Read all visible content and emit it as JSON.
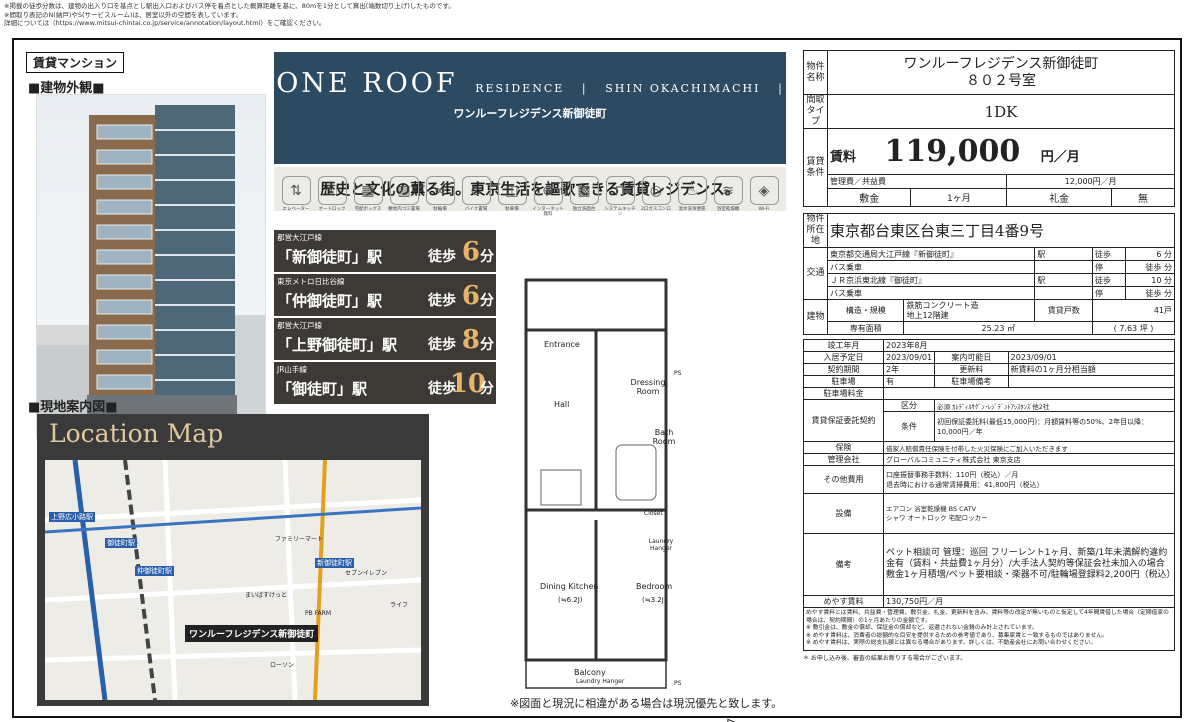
{
  "header_notes": [
    "※掲載の徒歩分数は、建物の出入り口を基点とし駅出入口およびバス停を着点とした概算距離を基に、80mを1分として算出(端数切り上げ)したものです。",
    "※間取り表記のN(納戸)やS(サービスルーム)は、居室以外の空間を表しています。",
    "詳細については（https://www.mitsui-chintai.co.jp/service/annotation/layout.html）をご確認ください。"
  ],
  "listing_type": "賃貸マンション",
  "exterior_heading": "■建物外観■",
  "map_heading": "■現地案内図■",
  "brand": {
    "main": "ONE ROOF",
    "residence": "RESIDENCE",
    "area": "SHIN OKACHIMACHI",
    "japanese": "ワンルーフレジデンス新御徒町"
  },
  "catch_copy": "歴史と文化の薫る街。東京生活を謳歌できる賃貸レジデンス。",
  "amenities": [
    {
      "icon": "elevator-icon",
      "glyph": "⇅",
      "label": "エレベーター"
    },
    {
      "icon": "autolock-icon",
      "glyph": "🔒",
      "label": "オートロック"
    },
    {
      "icon": "delivery-box-icon",
      "glyph": "▦",
      "label": "宅配ボックス"
    },
    {
      "icon": "trash-icon",
      "glyph": "🗑",
      "label": "敷地内ゴミ置場"
    },
    {
      "icon": "bicycle-icon",
      "glyph": "🚲",
      "label": "駐輪場"
    },
    {
      "icon": "bike-icon",
      "glyph": "🛵",
      "label": "バイク置場"
    },
    {
      "icon": "car-icon",
      "glyph": "🚗",
      "label": "駐車場"
    },
    {
      "icon": "internet-icon",
      "glyph": "🌐",
      "label": "インターネット無料"
    },
    {
      "icon": "floor-heating-icon",
      "glyph": "▩",
      "label": "独立洗面台"
    },
    {
      "icon": "kitchen-icon",
      "glyph": "⊓",
      "label": "システムキッチン"
    },
    {
      "icon": "stove-icon",
      "glyph": "◎",
      "label": "2口ガスコンロ"
    },
    {
      "icon": "bidet-icon",
      "glyph": "♨",
      "label": "温水洗浄便座"
    },
    {
      "icon": "bath-dryer-icon",
      "glyph": "≋",
      "label": "浴室乾燥機"
    },
    {
      "icon": "wifi-icon",
      "glyph": "◈",
      "label": "Wi-Fi"
    }
  ],
  "stations": [
    {
      "line": "都営大江戸線",
      "name": "「新御徒町」駅",
      "walk": "徒歩",
      "minutes": "6",
      "unit": "分"
    },
    {
      "line": "東京メトロ日比谷線",
      "name": "「仲御徒町」駅",
      "walk": "徒歩",
      "minutes": "6",
      "unit": "分"
    },
    {
      "line": "都営大江戸線",
      "name": "「上野御徒町」駅",
      "walk": "徒歩",
      "minutes": "8",
      "unit": "分"
    },
    {
      "line": "JR山手線",
      "name": "「御徒町」駅",
      "walk": "徒歩",
      "minutes": "10",
      "unit": "分"
    }
  ],
  "map": {
    "title": "Location Map",
    "pin_label": "ワンルーフレジデンス新御徒町",
    "labels": [
      "上野広小路駅",
      "御徒町駅",
      "仲御徒町駅",
      "新御徒町駅",
      "ファミリーマート",
      "セブンイレブン",
      "ローソン",
      "まいばすけっと",
      "PB FARM",
      "ライフ"
    ]
  },
  "plan": {
    "rooms": [
      "Entrance",
      "Dressing Room",
      "Hall",
      "Bath Room",
      "Closet",
      "Laundry Hanger",
      "Dining Kitchen",
      "(≒6.2J)",
      "Bedroom",
      "(≒3.2J)",
      "Balcony",
      "Laundry Hanger",
      "PS",
      "PS"
    ],
    "note": "※図面と現況に相違がある場合は現況優先と致します。"
  },
  "info": {
    "name_label": "物件名称",
    "name_line1": "ワンルーフレジデンス新御徒町",
    "name_line2": "８０２号室",
    "layout_label": "間取タイプ",
    "layout": "1DK",
    "rent_section_label": "賃貸条件",
    "rent_label": "賃料",
    "rent_value": "119,000",
    "rent_unit": "円／月",
    "fee_label": "管理費／共益費",
    "fee_value": "12,000円／月",
    "deposit_label": "敷金",
    "deposit_value": "1ヶ月",
    "key_money_label": "礼金",
    "key_money_value": "無",
    "address_label": "物件所在地",
    "address": "東京都台東区台東三丁目4番9号",
    "traffic_label": "交通",
    "traffic": [
      {
        "line": "東京都交通局大江戸線『新御徒町』",
        "station": "駅",
        "walk": "徒歩",
        "min": "6",
        "unit": "分"
      },
      {
        "line": "バス乗車",
        "station": "",
        "walk": "停",
        "min": "徒歩",
        "unit": "分"
      },
      {
        "line": "ＪＲ京浜東北線『御徒町』",
        "station": "駅",
        "walk": "徒歩",
        "min": "10",
        "unit": "分"
      },
      {
        "line": "バス乗車",
        "station": "",
        "walk": "停",
        "min": "徒歩",
        "unit": "分"
      }
    ],
    "building_label": "建物",
    "structure_label": "構造・規模",
    "structure_value1": "鉄筋コンクリート造",
    "structure_value2": "地上12階建",
    "units_label": "賃貸戸数",
    "units_value": "41戸",
    "area_label": "専有面積",
    "area_value": "25.23 ㎡",
    "area_tsubo": "( 7.63 坪 )",
    "built_label": "竣工年月",
    "built_value": "2023年8月",
    "movein_label": "入居予定日",
    "movein_value": "2023/09/01",
    "guide_label": "案内可能日",
    "guide_value": "2023/09/01",
    "term_label": "契約期間",
    "term_value": "2年",
    "renew_label": "更新料",
    "renew_value": "新賃料の1ヶ月分相当額",
    "parking_label": "駐車場",
    "parking_value": "有",
    "parking_note_label": "駐車場備考",
    "parking_fee_label": "駐車場料金",
    "guarantee_label": "賃貸保証委託契約",
    "guarantee_kubun_label": "区分",
    "guarantee_kubun": "必須 ｶﾚﾃﾞｨﾙｻｸﾞﾝ･ﾚｼﾞﾃﾞﾝﾄｱｼｽﾀﾝｽ 他2社",
    "guarantee_cond_label": "条件",
    "guarantee_cond": "初回保証委託料(最低15,000円)：月額賃料等の50%、2年目以降：10,000円／年",
    "insurance_label": "保険",
    "insurance_value": "借家人賠償責任保険を付帯した火災保険にご加入いただきます",
    "manager_label": "管理会社",
    "manager_value": "グローバルコミュニティ株式会社 東京支店",
    "other_label": "その他費用",
    "other_value1": "口座振替事務手数料：110円（税込）／月",
    "other_value2": "退去時における通常清掃費用：41,800円（税込）",
    "equip_label": "設備",
    "equip_value1": "エアコン 浴室乾燥機 BS CATV",
    "equip_value2": "シャワ オートロック 宅配ロッカー",
    "remarks_label": "備考",
    "remarks_value": "ペット相談可 管理：巡回 フリーレント1ヶ月、新築/1年未満解約違約金有（賃料・共益費1ヶ月分）/大手法人契約等保証会社未加入の場合敷金1ヶ月積増/ペット要相談・楽器不可/駐輪場登録料2,200円（税込）",
    "guide_rent_label": "めやす賃料",
    "guide_rent_value": "130,750円／月",
    "footnotes": [
      "めやす賃料とは賃料、共益費・管理費、敷引金、礼金、更新料を含み、賃料等の改定が無いものと仮定して4年間賃借した場合（定期借家の場合は、契約期間）の1ヶ月あたりの金額です。",
      "※ 敷引金は、敷金の償却、保証金の償却など、返還されない金銭のみ計上されています。",
      "※ めやす賃料は、消費者の総額的な目安を提供するための参考値であり、募集家賃と一致するものではありません。",
      "※ めやす賃料は、実際の総支払額とは異なる場合があります。詳しくは、不動産会社にお問い合わせください。"
    ],
    "bottom_note": "＊ お申し込み後、審査の結果お断りする場合がございます。"
  }
}
